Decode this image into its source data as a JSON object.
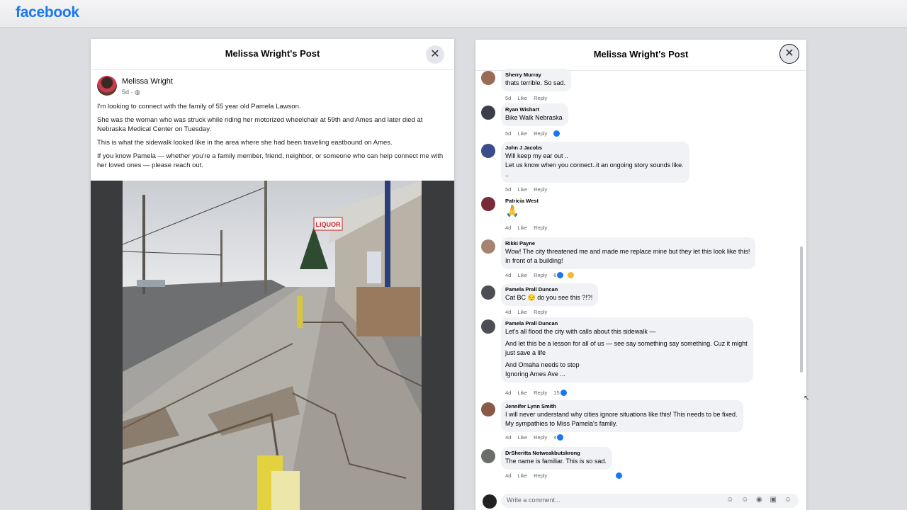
{
  "app": {
    "logo": "facebook"
  },
  "post_modal": {
    "title": "Melissa Wright's Post",
    "close_label": "✕",
    "author": {
      "name": "Melissa Wright",
      "meta": "5d · ◍"
    },
    "paragraphs": [
      "I'm looking to connect with the family of 55 year old Pamela Lawson.",
      "She was the woman who was struck while riding her motorized wheelchair at 59th and Ames and later died at Nebraska Medical Center on Tuesday.",
      "This is what the sidewalk looked like in the area where she had been traveling eastbound on Ames.",
      "If you know Pamela — whether you're a family member, friend, neighbor, or someone who can help connect me with her loved ones — please reach out."
    ],
    "photo_sign_text": "LIQUOR"
  },
  "comments_modal": {
    "title": "Melissa Wright's Post",
    "close_label": "✕",
    "comments": [
      {
        "name": "Sherry Murray",
        "lines": [
          "thats terrible. So sad."
        ],
        "time": "5d",
        "like": "Like",
        "reply": "Reply",
        "reactions": ""
      },
      {
        "name": "Ryan Wishart",
        "lines": [
          "Bike Walk Nebraska"
        ],
        "time": "5d",
        "like": "Like",
        "reply": "Reply",
        "reactions": ""
      },
      {
        "name": "John J Jacobs",
        "lines": [
          "Will keep my ear out ..",
          "Let us know when you connect..it an ongoing story sounds like.",
          ".."
        ],
        "time": "5d",
        "like": "Like",
        "reply": "Reply",
        "reactions": ""
      },
      {
        "name": "Patricia West",
        "lines": [
          "🙏"
        ],
        "time": "4d",
        "like": "Like",
        "reply": "Reply",
        "reactions": ""
      },
      {
        "name": "Rikki Payne",
        "lines": [
          "Wow! The city threatened me and made me replace mine but they let this look like this!",
          "In front of a building!"
        ],
        "time": "4d",
        "like": "Like",
        "reply": "Reply",
        "reactions": "6"
      },
      {
        "name": "Pamela Prall Duncan",
        "lines": [
          "Cat BC 😔 do you see this ?!?!"
        ],
        "time": "4d",
        "like": "Like",
        "reply": "Reply",
        "reactions": ""
      },
      {
        "name": "Pamela Prall Duncan",
        "lines": [
          "Let's all flood the city with calls about this sidewalk —",
          "And let this be a lesson for all of us — see say something say something. Cuz it might",
          "just save a life",
          "And Omaha needs to stop",
          "Ignoring Ames Ave ..."
        ],
        "time": "4d",
        "like": "Like",
        "reply": "Reply",
        "reactions": "15"
      },
      {
        "name": "Jennifer Lynn Smith",
        "lines": [
          "I will never understand why cities ignore situations like this! This needs to be fixed.",
          "My sympathies to Miss Pamela's family."
        ],
        "time": "4d",
        "like": "Like",
        "reply": "Reply",
        "reactions": "4"
      },
      {
        "name": "DrSheritta Notweakbutskrong",
        "lines": [
          "The name is familiar. This is so sad."
        ],
        "time": "4d",
        "like": "Like",
        "reply": "Reply",
        "reactions": ""
      }
    ],
    "comment_placeholder": "Write a comment...",
    "input_icons": "☺ ☺ ◉ ▣ ☺"
  }
}
